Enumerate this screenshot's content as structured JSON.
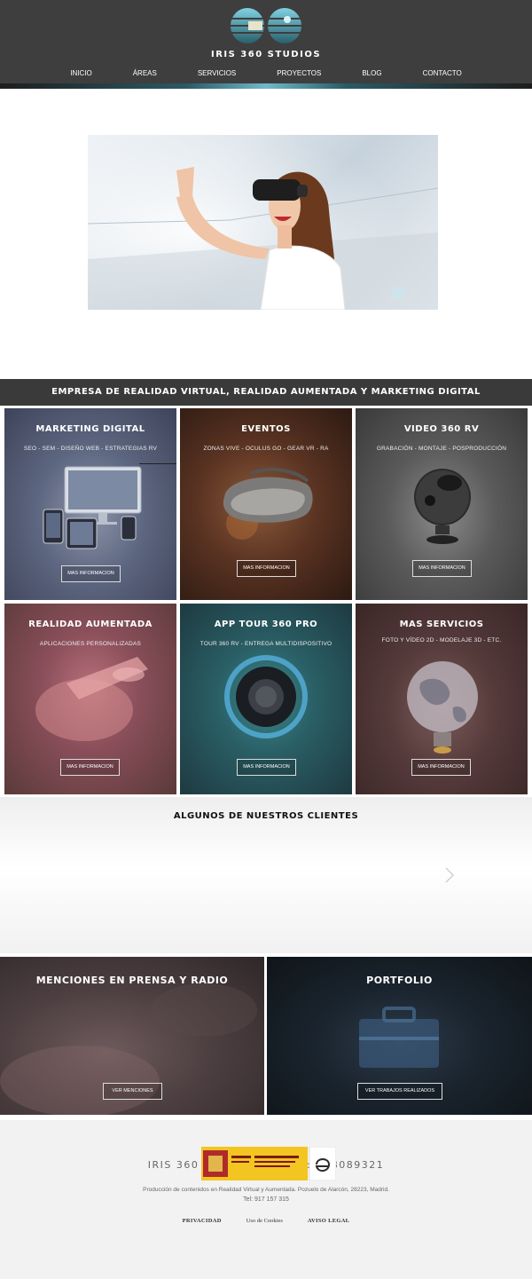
{
  "header": {
    "brand": "IRIS 360 STUDIOS",
    "nav": [
      "INICIO",
      "ÁREAS",
      "SERVICIOS",
      "PROYECTOS",
      "BLOG",
      "CONTACTO"
    ]
  },
  "banner": {
    "title": "EMPRESA DE REALIDAD VIRTUAL, REALIDAD AUMENTADA Y MARKETING DIGITAL"
  },
  "services": [
    {
      "title": "MARKETING DIGITAL",
      "subtitle": "SEO - SEM - DISEÑO WEB - ESTRATEGIAS RV",
      "button": "MAS INFORMACION"
    },
    {
      "title": "EVENTOS",
      "subtitle": "ZONAS VIVE - OCULUS GO - GEAR VR - RA",
      "button": "MAS INFORMACION"
    },
    {
      "title": "VIDEO 360 RV",
      "subtitle": "GRABACIÓN - MONTAJE - POSPRODUCCIÓN",
      "button": "MAS INFORMACION"
    },
    {
      "title": "REALIDAD AUMENTADA",
      "subtitle": "APLICACIONES PERSONALIZADAS",
      "button": "MAS INFORMACION"
    },
    {
      "title": "APP TOUR 360 PRO",
      "subtitle": "TOUR 360 RV - ENTREGA MULTIDISPOSITIVO",
      "button": "MAS INFORMACION"
    },
    {
      "title": "MAS SERVICIOS",
      "subtitle": "FOTO Y VÍDEO 2D - MODELAJE 3D - ETC.",
      "button": "MAS INFORMACION"
    }
  ],
  "clients": {
    "title": "ALGUNOS DE NUESTROS CLIENTES"
  },
  "press": {
    "title": "MENCIONES EN PRENSA Y RADIO",
    "button": "VER MENCIONES"
  },
  "portfolio": {
    "title": "PORTFOLIO",
    "button": "VER TRABAJOS REALIZADOS"
  },
  "footer": {
    "company": "IRIS 360 STUDIOS S.L.    CIF: B88089321",
    "address": "Producción de contenidos en Realidad Virtual y Aumentada. Pozuelo de Alarcón, 28223, Madrid.",
    "tel": "Tel: 917 157 315",
    "links": [
      "PRIVACIDAD",
      "Uso de Cookies",
      "AVISO LEGAL"
    ]
  },
  "colors": {
    "header_bg": "#3e3e3e",
    "accent": "#6fb9c9",
    "banner_bg": "#3a3a3a",
    "footer_bg": "#f2f2f2"
  }
}
